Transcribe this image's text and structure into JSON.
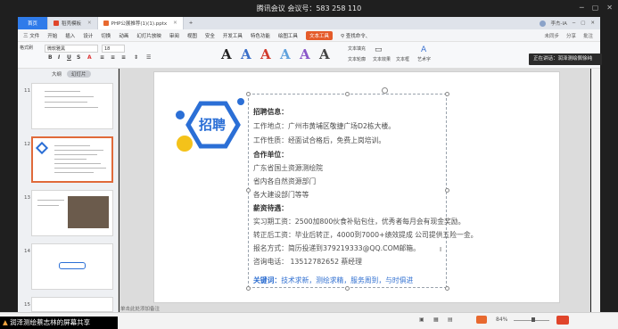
{
  "meeting": {
    "title": "腾讯会议 会议号：583 258 110"
  },
  "tabs": [
    {
      "label": "首页"
    },
    {
      "label": "稻壳模板"
    },
    {
      "label": "PHP公展推荐(1)(1).pptx"
    }
  ],
  "tabbar_right": {
    "user": "李杰-IA"
  },
  "menu": {
    "items": [
      "三 文件",
      "开始",
      "插入",
      "设计",
      "切换",
      "动画",
      "幻灯片放映",
      "审阅",
      "视图",
      "安全",
      "开发工具",
      "特色功能",
      "绘图工具",
      "文本工具"
    ],
    "search": "查找命令、",
    "right": [
      "未同步",
      "分享",
      "批注"
    ]
  },
  "ribbon": {
    "font_name": "微软雅黑",
    "font_size": "18",
    "text_fill": "文本填充",
    "text_outline": "文本轮廓",
    "text_effect": "文本效果",
    "text_box": "文本框",
    "art_word": "艺术字",
    "shape_fill": "形状填充",
    "shape_outline": "形状轮廓",
    "format_brush": "格式刷",
    "art_colors": [
      "#222222",
      "#3a6fc9",
      "#d13b2b",
      "#5fa2dd",
      "#8a57c9",
      "#444444"
    ]
  },
  "toast": "正在讲话：润泽测绘佩徐纯",
  "sidebar": {
    "tab_outline": "大纲",
    "tab_slides": "幻灯片",
    "slides": [
      11,
      12,
      13,
      14,
      15
    ]
  },
  "slide": {
    "badge": "招聘",
    "lines": [
      "招聘信息：",
      "工作地点：广州市黄埔区敬捷广场D2栋大楼。",
      "工作性质：经面试合格后，免费上岗培训。",
      "合作单位：",
      "广东省国土资源测绘院",
      "省内各自然资源部门",
      "各大建设部门等等",
      "薪资待遇：",
      "实习期工资：2500加800伙食补贴包住，优秀者每月会有现金奖励。",
      "转正后工资：毕业后转正，4000到7000+绩效提成 公司提供五险一金。",
      "报名方式：简历投递到379219333@QQ.COM邮箱。",
      "咨询电话： 13512782652 蔡经理"
    ],
    "keywords_label": "关键词：",
    "keywords_text": "技术求新，测绘求精，服务周到，与时俱进"
  },
  "notes_placeholder": "单击此处添加备注",
  "status": {
    "zoom": "84%",
    "share": "润泽测绘蔡志林的屏幕共享"
  },
  "brand_colors": {
    "accent": "#2f7bea",
    "badge_blue": "#2b6fd6",
    "badge_yellow": "#f4c21a",
    "selected_border": "#e06a3a"
  }
}
